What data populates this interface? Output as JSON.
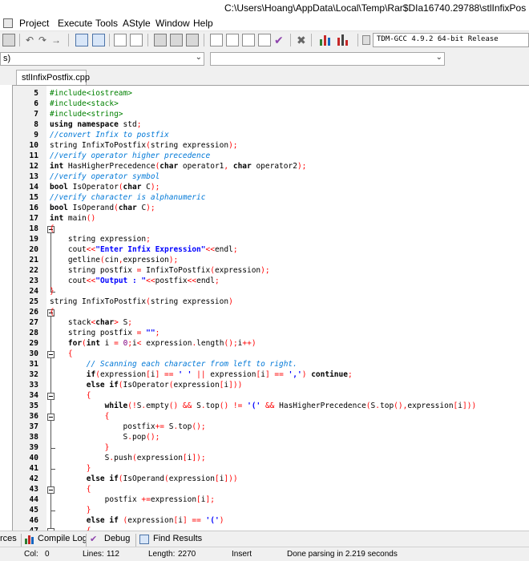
{
  "window": {
    "title": "C:\\Users\\Hoang\\AppData\\Local\\Temp\\Rar$DIa16740.29788\\stlInfixPos"
  },
  "menu": [
    "Project",
    "Execute",
    "Tools",
    "AStyle",
    "Window",
    "Help"
  ],
  "toolbar": {
    "compiler": "TDM-GCC 4.9.2 64-bit Release"
  },
  "combo": {
    "left_value": "s)"
  },
  "tab": {
    "label": "stlInfixPostfix.cpp"
  },
  "editor": {
    "line_numbers": [
      "5",
      "6",
      "7",
      "8",
      "9",
      "10",
      "11",
      "12",
      "13",
      "14",
      "15",
      "16",
      "17",
      "18",
      "19",
      "20",
      "21",
      "22",
      "23",
      "24",
      "25",
      "26",
      "27",
      "28",
      "29",
      "30",
      "31",
      "32",
      "33",
      "34",
      "35",
      "36",
      "37",
      "38",
      "39",
      "40",
      "41",
      "42",
      "43",
      "44",
      "45",
      "46",
      "47"
    ],
    "lines": [
      [
        [
          "p",
          "#include<iostream>"
        ]
      ],
      [
        [
          "p",
          "#include<stack>"
        ]
      ],
      [
        [
          "p",
          "#include<string>"
        ]
      ],
      [
        [
          "k",
          "using namespace"
        ],
        [
          "n",
          " std"
        ],
        [
          "o",
          ";"
        ]
      ],
      [
        [
          "c",
          "//convert Infix to postfix"
        ]
      ],
      [
        [
          "n",
          "string InfixToPostfix"
        ],
        [
          "o",
          "("
        ],
        [
          "n",
          "string expression"
        ],
        [
          "o",
          ");"
        ]
      ],
      [
        [
          "c",
          "//verify operator higher precedence"
        ]
      ],
      [
        [
          "k",
          "int"
        ],
        [
          "n",
          " HasHigherPrecedence"
        ],
        [
          "o",
          "("
        ],
        [
          "k",
          "char"
        ],
        [
          "n",
          " operator1"
        ],
        [
          "o",
          ","
        ],
        [
          "k",
          " char"
        ],
        [
          "n",
          " operator2"
        ],
        [
          "o",
          ");"
        ]
      ],
      [
        [
          "c",
          "//verify operator symbol"
        ]
      ],
      [
        [
          "k",
          "bool"
        ],
        [
          "n",
          " IsOperator"
        ],
        [
          "o",
          "("
        ],
        [
          "k",
          "char"
        ],
        [
          "n",
          " C"
        ],
        [
          "o",
          ");"
        ]
      ],
      [
        [
          "c",
          "//verify character is alphanumeric"
        ]
      ],
      [
        [
          "k",
          "bool"
        ],
        [
          "n",
          " IsOperand"
        ],
        [
          "o",
          "("
        ],
        [
          "k",
          "char"
        ],
        [
          "n",
          " C"
        ],
        [
          "o",
          ");"
        ]
      ],
      [
        [
          "k",
          "int"
        ],
        [
          "n",
          " main"
        ],
        [
          "o",
          "()"
        ]
      ],
      [
        [
          "o",
          "{"
        ]
      ],
      [
        [
          "n",
          "    string expression"
        ],
        [
          "o",
          ";"
        ]
      ],
      [
        [
          "n",
          "    cout"
        ],
        [
          "o",
          "<<"
        ],
        [
          "s",
          "\"Enter Infix Expression\""
        ],
        [
          "o",
          "<<"
        ],
        [
          "n",
          "endl"
        ],
        [
          "o",
          ";"
        ]
      ],
      [
        [
          "n",
          "    getline"
        ],
        [
          "o",
          "("
        ],
        [
          "n",
          "cin"
        ],
        [
          "o",
          ","
        ],
        [
          "n",
          "expression"
        ],
        [
          "o",
          ");"
        ]
      ],
      [
        [
          "n",
          "    string postfix "
        ],
        [
          "o",
          "="
        ],
        [
          "n",
          " InfixToPostfix"
        ],
        [
          "o",
          "("
        ],
        [
          "n",
          "expression"
        ],
        [
          "o",
          ");"
        ]
      ],
      [
        [
          "n",
          "    cout"
        ],
        [
          "o",
          "<<"
        ],
        [
          "s",
          "\"Output : \""
        ],
        [
          "o",
          "<<"
        ],
        [
          "n",
          "postfix"
        ],
        [
          "o",
          "<<"
        ],
        [
          "n",
          "endl"
        ],
        [
          "o",
          ";"
        ]
      ],
      [
        [
          "o",
          "}"
        ]
      ],
      [
        [
          "n",
          "string InfixToPostfix"
        ],
        [
          "o",
          "("
        ],
        [
          "n",
          "string expression"
        ],
        [
          "o",
          ")"
        ]
      ],
      [
        [
          "o",
          "{"
        ]
      ],
      [
        [
          "n",
          "    stack"
        ],
        [
          "o",
          "<"
        ],
        [
          "k",
          "char"
        ],
        [
          "o",
          ">"
        ],
        [
          "n",
          " S"
        ],
        [
          "o",
          ";"
        ]
      ],
      [
        [
          "n",
          "    string postfix "
        ],
        [
          "o",
          "="
        ],
        [
          "s",
          " \"\""
        ],
        [
          "o",
          ";"
        ]
      ],
      [
        [
          "k",
          "    for"
        ],
        [
          "o",
          "("
        ],
        [
          "k",
          "int"
        ],
        [
          "n",
          " i "
        ],
        [
          "o",
          "="
        ],
        [
          "num",
          " 0"
        ],
        [
          "o",
          ";"
        ],
        [
          "n",
          "i"
        ],
        [
          "o",
          "<"
        ],
        [
          "n",
          " expression"
        ],
        [
          "o",
          "."
        ],
        [
          "n",
          "length"
        ],
        [
          "o",
          "();"
        ],
        [
          "n",
          "i"
        ],
        [
          "o",
          "++)"
        ]
      ],
      [
        [
          "o",
          "    {"
        ]
      ],
      [
        [
          "c",
          "        // Scanning each character from left to right."
        ]
      ],
      [
        [
          "k",
          "        if"
        ],
        [
          "o",
          "("
        ],
        [
          "n",
          "expression"
        ],
        [
          "o",
          "["
        ],
        [
          "n",
          "i"
        ],
        [
          "o",
          "] == "
        ],
        [
          "s",
          "' '"
        ],
        [
          "o",
          " || "
        ],
        [
          "n",
          "expression"
        ],
        [
          "o",
          "["
        ],
        [
          "n",
          "i"
        ],
        [
          "o",
          "] == "
        ],
        [
          "s",
          "','"
        ],
        [
          "o",
          ")"
        ],
        [
          "k",
          " continue"
        ],
        [
          "o",
          ";"
        ]
      ],
      [
        [
          "k",
          "        else if"
        ],
        [
          "o",
          "("
        ],
        [
          "n",
          "IsOperator"
        ],
        [
          "o",
          "("
        ],
        [
          "n",
          "expression"
        ],
        [
          "o",
          "["
        ],
        [
          "n",
          "i"
        ],
        [
          "o",
          "]))"
        ]
      ],
      [
        [
          "o",
          "        {"
        ]
      ],
      [
        [
          "k",
          "            while"
        ],
        [
          "o",
          "(!"
        ],
        [
          "n",
          "S"
        ],
        [
          "o",
          "."
        ],
        [
          "n",
          "empty"
        ],
        [
          "o",
          "() && "
        ],
        [
          "n",
          "S"
        ],
        [
          "o",
          "."
        ],
        [
          "n",
          "top"
        ],
        [
          "o",
          "() != "
        ],
        [
          "s",
          "'('"
        ],
        [
          "o",
          " && "
        ],
        [
          "n",
          "HasHigherPrecedence"
        ],
        [
          "o",
          "("
        ],
        [
          "n",
          "S"
        ],
        [
          "o",
          "."
        ],
        [
          "n",
          "top"
        ],
        [
          "o",
          "(),"
        ],
        [
          "n",
          "expression"
        ],
        [
          "o",
          "["
        ],
        [
          "n",
          "i"
        ],
        [
          "o",
          "]))"
        ]
      ],
      [
        [
          "o",
          "            {"
        ]
      ],
      [
        [
          "n",
          "                postfix"
        ],
        [
          "o",
          "+="
        ],
        [
          "n",
          " S"
        ],
        [
          "o",
          "."
        ],
        [
          "n",
          "top"
        ],
        [
          "o",
          "();"
        ]
      ],
      [
        [
          "n",
          "                S"
        ],
        [
          "o",
          "."
        ],
        [
          "n",
          "pop"
        ],
        [
          "o",
          "();"
        ]
      ],
      [
        [
          "o",
          "            }"
        ]
      ],
      [
        [
          "n",
          "            S"
        ],
        [
          "o",
          "."
        ],
        [
          "n",
          "push"
        ],
        [
          "o",
          "("
        ],
        [
          "n",
          "expression"
        ],
        [
          "o",
          "["
        ],
        [
          "n",
          "i"
        ],
        [
          "o",
          "]);"
        ]
      ],
      [
        [
          "o",
          "        }"
        ]
      ],
      [
        [
          "k",
          "        else if"
        ],
        [
          "o",
          "("
        ],
        [
          "n",
          "IsOperand"
        ],
        [
          "o",
          "("
        ],
        [
          "n",
          "expression"
        ],
        [
          "o",
          "["
        ],
        [
          "n",
          "i"
        ],
        [
          "o",
          "]))"
        ]
      ],
      [
        [
          "o",
          "        {"
        ]
      ],
      [
        [
          "n",
          "            postfix "
        ],
        [
          "o",
          "+="
        ],
        [
          "n",
          "expression"
        ],
        [
          "o",
          "["
        ],
        [
          "n",
          "i"
        ],
        [
          "o",
          "];"
        ]
      ],
      [
        [
          "o",
          "        }"
        ]
      ],
      [
        [
          "k",
          "        else if"
        ],
        [
          "n",
          " "
        ],
        [
          "o",
          "("
        ],
        [
          "n",
          "expression"
        ],
        [
          "o",
          "["
        ],
        [
          "n",
          "i"
        ],
        [
          "o",
          "] == "
        ],
        [
          "s",
          "'('"
        ],
        [
          "o",
          ")"
        ]
      ],
      [
        [
          "o",
          "        {"
        ]
      ]
    ]
  },
  "bottom_tabs": {
    "left_fragment": "rces",
    "compile_log": "Compile Log",
    "debug": "Debug",
    "find_results": "Find Results"
  },
  "status": {
    "col": "Col:",
    "col_val": "0",
    "lines": "Lines:",
    "lines_val": "112",
    "length": "Length:",
    "length_val": "2270",
    "mode": "Insert",
    "message": "Done parsing in 2.219 seconds"
  },
  "colors": {
    "preprocessor": "#008000",
    "operator": "#ff0000",
    "string": "#0000ff",
    "comment": "#0078d7",
    "number": "#800080"
  }
}
